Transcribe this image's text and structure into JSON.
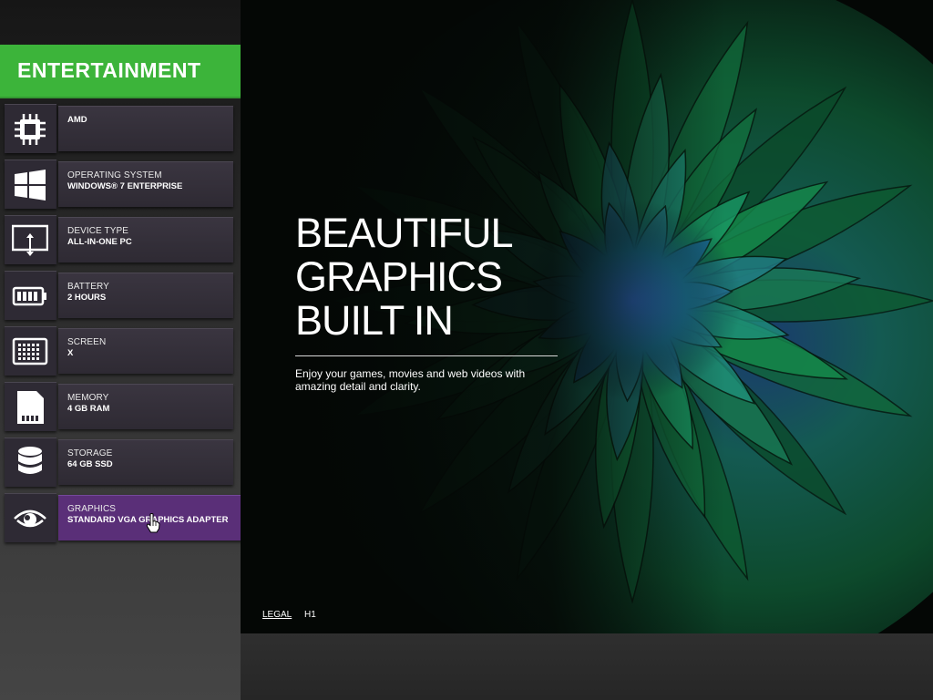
{
  "category": {
    "title": "ENTERTAINMENT",
    "color": "#3cb43a"
  },
  "specs": [
    {
      "icon": "processor-chip-icon",
      "label": "",
      "value": "AMD"
    },
    {
      "icon": "windows-logo-icon",
      "label": "OPERATING SYSTEM",
      "value": "WINDOWS® 7 ENTERPRISE"
    },
    {
      "icon": "monitor-icon",
      "label": "DEVICE TYPE",
      "value": "ALL-IN-ONE PC"
    },
    {
      "icon": "battery-icon",
      "label": "BATTERY",
      "value": "2 HOURS"
    },
    {
      "icon": "screen-pixels-icon",
      "label": "SCREEN",
      "value": "X"
    },
    {
      "icon": "memory-card-icon",
      "label": "MEMORY",
      "value": "4 GB RAM"
    },
    {
      "icon": "storage-database-icon",
      "label": "STORAGE",
      "value": "64 GB SSD"
    },
    {
      "icon": "eye-icon",
      "label": "GRAPHICS",
      "value": "STANDARD VGA GRAPHICS ADAPTER",
      "active": true
    }
  ],
  "active_color": "#5a2f78",
  "hero": {
    "headline_lines": [
      "BEAUTIFUL",
      "GRAPHICS",
      "BUILT IN"
    ],
    "tagline": "Enjoy your games, movies and web videos with amazing detail and clarity.",
    "image": "green-blue-dahlia-flower",
    "legal_label": "LEGAL",
    "version_label": "H1"
  }
}
